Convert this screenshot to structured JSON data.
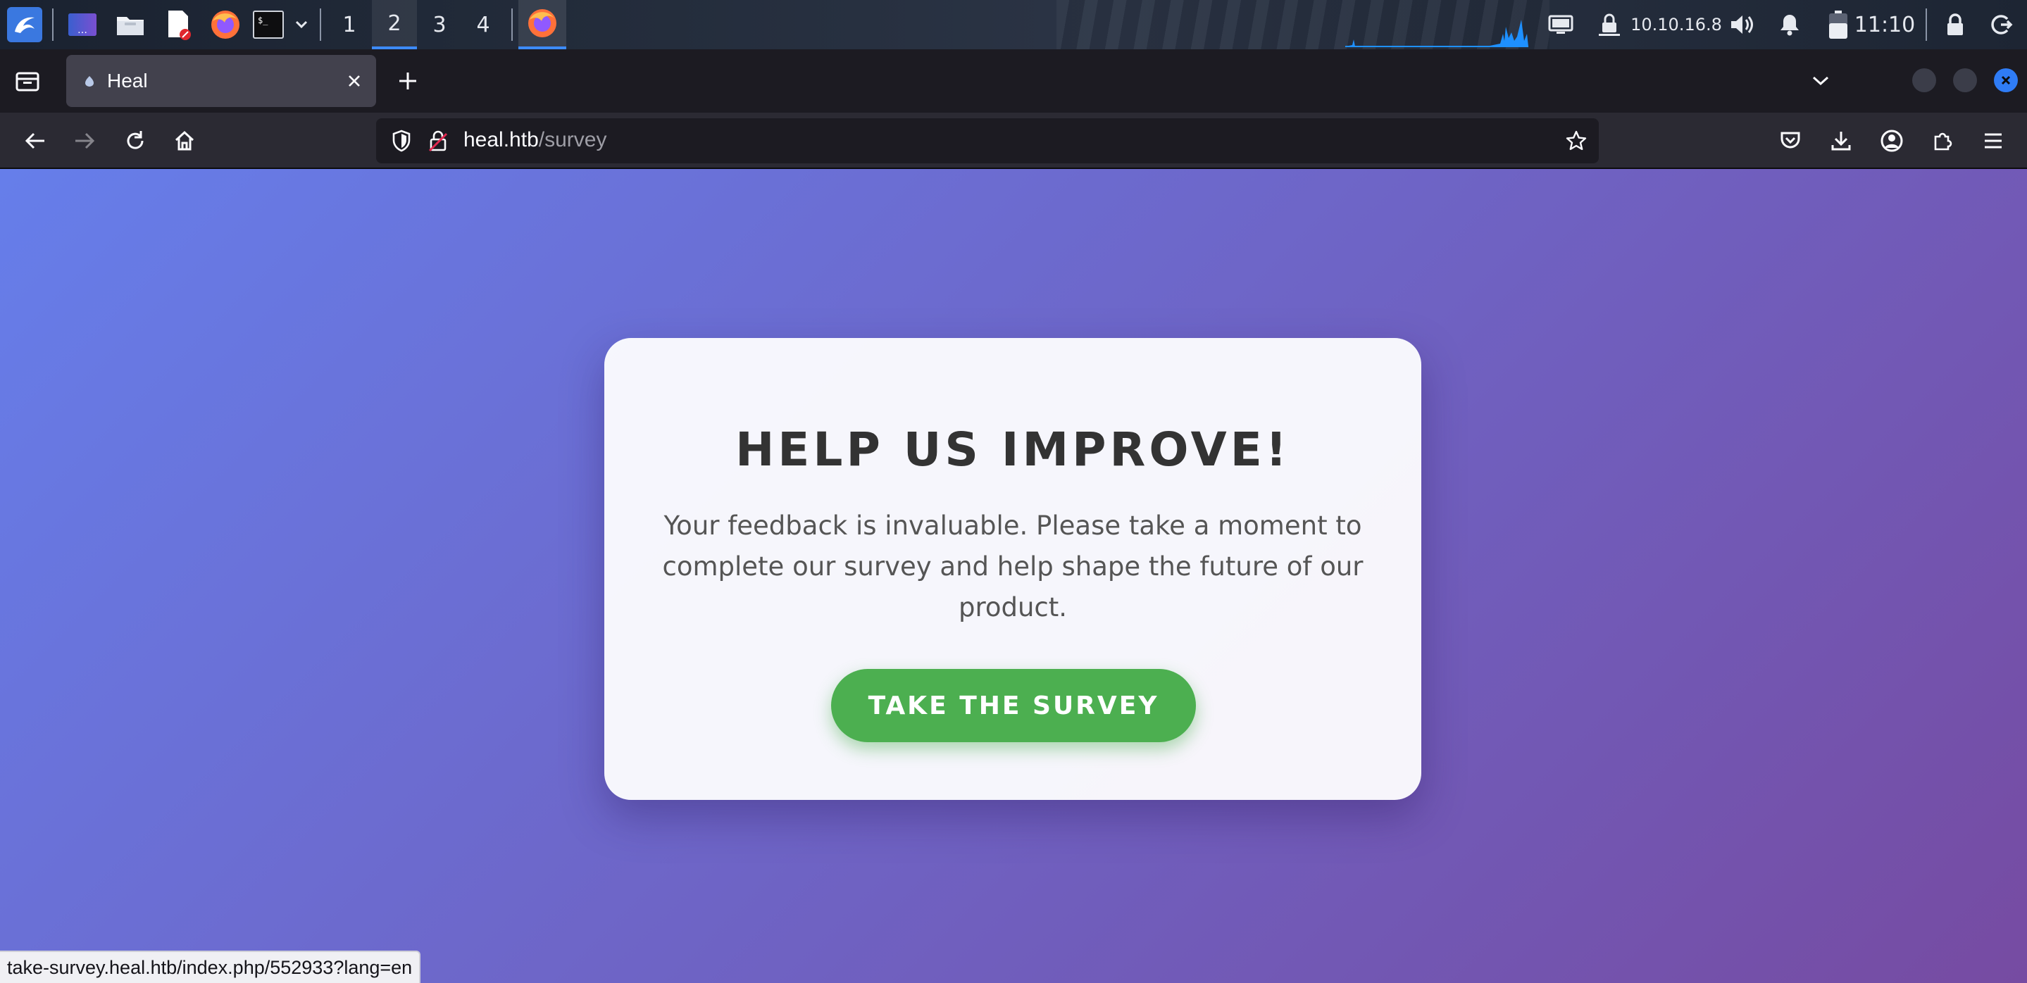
{
  "taskbar": {
    "workspaces": [
      "1",
      "2",
      "3",
      "4"
    ],
    "active_workspace": "2",
    "ip_address": "10.10.16.8",
    "clock": "11:10"
  },
  "browser": {
    "tab_title": "Heal",
    "url_host": "heal.htb",
    "url_path": "/survey",
    "status_url": "take-survey.heal.htb/index.php/552933?lang=en"
  },
  "page": {
    "heading": "HELP US IMPROVE!",
    "description": "Your feedback is invaluable. Please take a moment to complete our survey and help shape the future of our product.",
    "cta_label": "TAKE THE SURVEY"
  },
  "colors": {
    "gradient_start": "#667eea",
    "gradient_end": "#764ba2",
    "cta": "#4caf50",
    "heading": "#333333"
  }
}
